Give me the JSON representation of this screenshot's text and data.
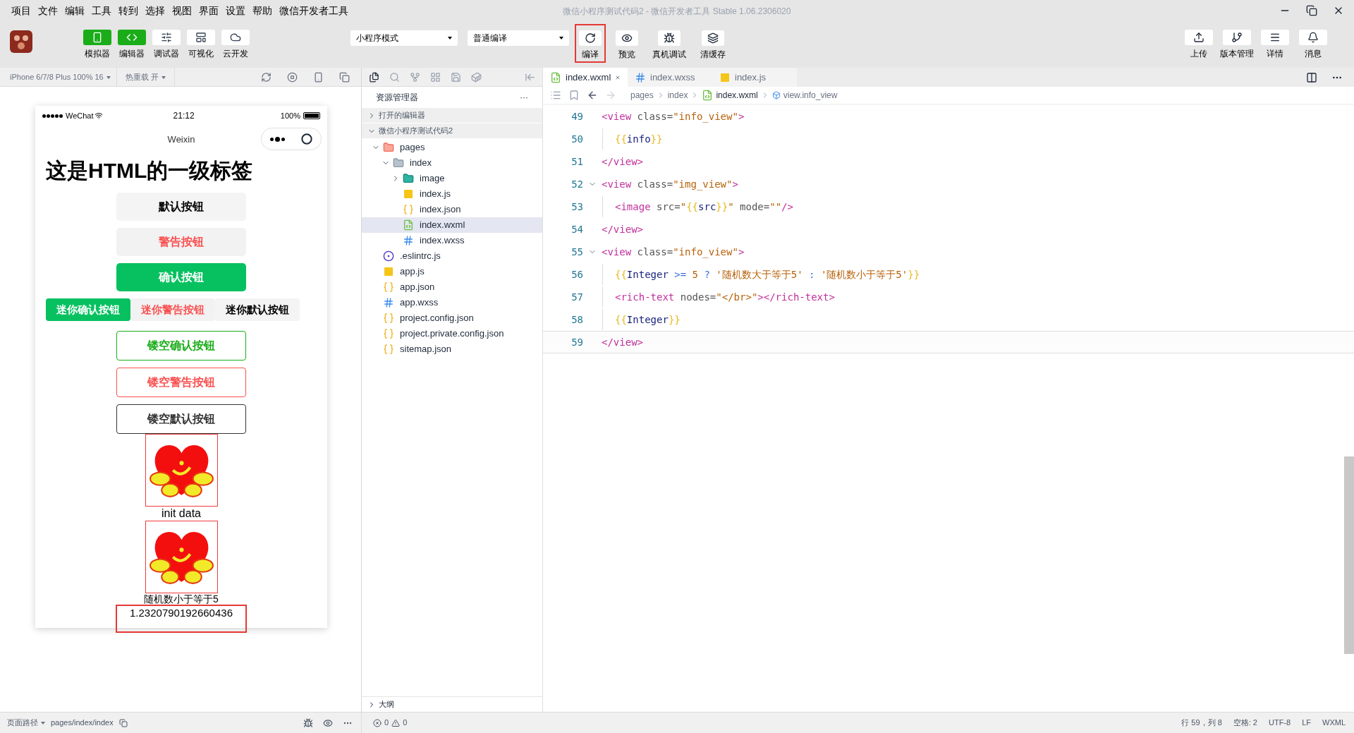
{
  "menu": [
    "项目",
    "文件",
    "编辑",
    "工具",
    "转到",
    "选择",
    "视图",
    "界面",
    "设置",
    "帮助",
    "微信开发者工具"
  ],
  "window": {
    "title": "微信小程序测试代码2 - 微信开发者工具 Stable 1.06.2306020"
  },
  "toolbar_left": [
    {
      "label": "模拟器",
      "kind": "simulator",
      "selected": true
    },
    {
      "label": "编辑器",
      "kind": "editor",
      "selected": true
    },
    {
      "label": "调试器",
      "kind": "debugger",
      "selected": false
    },
    {
      "label": "可视化",
      "kind": "visual",
      "selected": false
    },
    {
      "label": "云开发",
      "kind": "cloud",
      "selected": false
    }
  ],
  "mode_select": "小程序模式",
  "compile_select": "普通编译",
  "toolbar_mid": [
    {
      "label": "编译",
      "kind": "compile",
      "highlighted": true
    },
    {
      "label": "预览",
      "kind": "preview",
      "highlighted": false
    },
    {
      "label": "真机调试",
      "kind": "debug",
      "highlighted": false
    },
    {
      "label": "清缓存",
      "kind": "cache",
      "highlighted": false
    }
  ],
  "toolbar_right": [
    {
      "label": "上传",
      "kind": "upload"
    },
    {
      "label": "版本管理",
      "kind": "version"
    },
    {
      "label": "详情",
      "kind": "details"
    },
    {
      "label": "消息",
      "kind": "messages"
    }
  ],
  "sim_bar": {
    "device": "iPhone 6/7/8 Plus 100% 16",
    "hot_reload": "热重载 开"
  },
  "phone": {
    "carrier": "WeChat",
    "time": "21:12",
    "battery": "100%",
    "nav_title": "Weixin",
    "heading": "这是HTML的一级标签",
    "buttons": [
      {
        "label": "默认按钮",
        "kind": "default"
      },
      {
        "label": "警告按钮",
        "kind": "warn"
      },
      {
        "label": "确认按钮",
        "kind": "primary"
      }
    ],
    "mini_buttons": [
      {
        "label": "迷你确认按钮",
        "kind": "primary"
      },
      {
        "label": "迷你警告按钮",
        "kind": "warn"
      },
      {
        "label": "迷你默认按钮",
        "kind": "default"
      }
    ],
    "plain_buttons": [
      {
        "label": "镂空确认按钮",
        "kind": "primary"
      },
      {
        "label": "镂空警告按钮",
        "kind": "warn"
      },
      {
        "label": "镂空默认按钮",
        "kind": "default"
      }
    ],
    "info": "init data",
    "random_text": "随机数小于等于5",
    "integer": "1.2320790192660436"
  },
  "explorer": {
    "title": "资源管理器",
    "more": "···",
    "sections": [
      {
        "label": "打开的编辑器",
        "expanded": false
      },
      {
        "label": "微信小程序测试代码2",
        "expanded": true
      }
    ],
    "tree": [
      {
        "label": "pages",
        "kind": "folder-pages",
        "expanded": true,
        "selected": false,
        "children": [
          {
            "label": "index",
            "kind": "folder",
            "expanded": true,
            "selected": false,
            "children": [
              {
                "label": "image",
                "kind": "folder-image",
                "expanded": false,
                "selected": false
              },
              {
                "label": "index.js",
                "kind": "js",
                "selected": false
              },
              {
                "label": "index.json",
                "kind": "json",
                "selected": false
              },
              {
                "label": "index.wxml",
                "kind": "wxml",
                "selected": true
              },
              {
                "label": "index.wxss",
                "kind": "wxss",
                "selected": false
              }
            ]
          }
        ]
      },
      {
        "label": ".eslintrc.js",
        "kind": "eslint",
        "selected": false
      },
      {
        "label": "app.js",
        "kind": "js",
        "selected": false
      },
      {
        "label": "app.json",
        "kind": "json",
        "selected": false
      },
      {
        "label": "app.wxss",
        "kind": "wxss",
        "selected": false
      },
      {
        "label": "project.config.json",
        "kind": "json",
        "selected": false
      },
      {
        "label": "project.private.config.json",
        "kind": "json",
        "selected": false
      },
      {
        "label": "sitemap.json",
        "kind": "json",
        "selected": false
      }
    ],
    "outline": "大纲"
  },
  "editor": {
    "tabs": [
      {
        "label": "index.wxml",
        "kind": "wxml",
        "selected": true
      },
      {
        "label": "index.wxss",
        "kind": "wxss",
        "selected": false
      },
      {
        "label": "index.js",
        "kind": "js",
        "selected": false
      }
    ],
    "breadcrumb": [
      "pages",
      "index",
      "index.wxml",
      "view.info_view"
    ],
    "lines": [
      {
        "number": "49",
        "fold": false,
        "current": false,
        "tokens": [
          {
            "kind": "tag",
            "s": "<view"
          },
          {
            "kind": "attr",
            "s": " class="
          },
          {
            "kind": "str",
            "s": "\"info_view\""
          },
          {
            "kind": "tag",
            "s": ">"
          }
        ],
        "children": [
          {
            "number": "50",
            "fold": false,
            "current": false,
            "tokens": [
              {
                "kind": "brace",
                "s": "{{"
              },
              {
                "kind": "var",
                "s": "info"
              },
              {
                "kind": "brace",
                "s": "}}"
              }
            ]
          }
        ]
      },
      {
        "number": "51",
        "fold": false,
        "current": false,
        "tokens": [
          {
            "kind": "tag",
            "s": "</view>"
          }
        ]
      },
      {
        "number": "52",
        "fold": true,
        "current": false,
        "tokens": [
          {
            "kind": "tag",
            "s": "<view"
          },
          {
            "kind": "attr",
            "s": " class="
          },
          {
            "kind": "str",
            "s": "\"img_view\""
          },
          {
            "kind": "tag",
            "s": ">"
          }
        ],
        "children": [
          {
            "number": "53",
            "fold": false,
            "current": false,
            "tokens": [
              {
                "kind": "tag",
                "s": "<image"
              },
              {
                "kind": "attr",
                "s": " src="
              },
              {
                "kind": "str",
                "s": "\""
              },
              {
                "kind": "brace",
                "s": "{{"
              },
              {
                "kind": "var",
                "s": "src"
              },
              {
                "kind": "brace",
                "s": "}}"
              },
              {
                "kind": "str",
                "s": "\""
              },
              {
                "kind": "attr",
                "s": " mode="
              },
              {
                "kind": "str",
                "s": "\"\""
              },
              {
                "kind": "tag",
                "s": "/>"
              }
            ]
          }
        ]
      },
      {
        "number": "54",
        "fold": false,
        "current": false,
        "tokens": [
          {
            "kind": "tag",
            "s": "</view>"
          }
        ]
      },
      {
        "number": "55",
        "fold": true,
        "current": false,
        "tokens": [
          {
            "kind": "tag",
            "s": "<view"
          },
          {
            "kind": "attr",
            "s": " class="
          },
          {
            "kind": "str",
            "s": "\"info_view\""
          },
          {
            "kind": "tag",
            "s": ">"
          }
        ],
        "children": [
          {
            "number": "56",
            "fold": false,
            "current": false,
            "tokens": [
              {
                "kind": "brace",
                "s": "{{"
              },
              {
                "kind": "var",
                "s": "Integer"
              },
              {
                "kind": "op",
                "s": " >= "
              },
              {
                "kind": "num",
                "s": "5"
              },
              {
                "kind": "op",
                "s": " ? "
              },
              {
                "kind": "str",
                "s": "'随机数大于等于5'"
              },
              {
                "kind": "op",
                "s": " : "
              },
              {
                "kind": "str",
                "s": "'随机数小于等于5'"
              },
              {
                "kind": "brace",
                "s": "}}"
              }
            ]
          },
          {
            "number": "57",
            "fold": false,
            "current": false,
            "tokens": [
              {
                "kind": "tag",
                "s": "<rich-text"
              },
              {
                "kind": "attr",
                "s": " nodes="
              },
              {
                "kind": "str",
                "s": "\"</br>\""
              },
              {
                "kind": "tag",
                "s": "></rich-text>"
              }
            ]
          },
          {
            "number": "58",
            "fold": false,
            "current": false,
            "tokens": [
              {
                "kind": "brace",
                "s": "{{"
              },
              {
                "kind": "var",
                "s": "Integer"
              },
              {
                "kind": "brace",
                "s": "}}"
              }
            ]
          }
        ]
      },
      {
        "number": "59",
        "fold": false,
        "current": true,
        "tokens": [
          {
            "kind": "tag",
            "s": "</view>"
          }
        ]
      }
    ]
  },
  "status_bar": {
    "page_path_label": "页面路径",
    "page_path": "pages/index/index",
    "errors": "0",
    "warnings": "0",
    "right": [
      "行 59，列 8",
      "空格: 2",
      "UTF-8",
      "LF",
      "WXML"
    ]
  }
}
